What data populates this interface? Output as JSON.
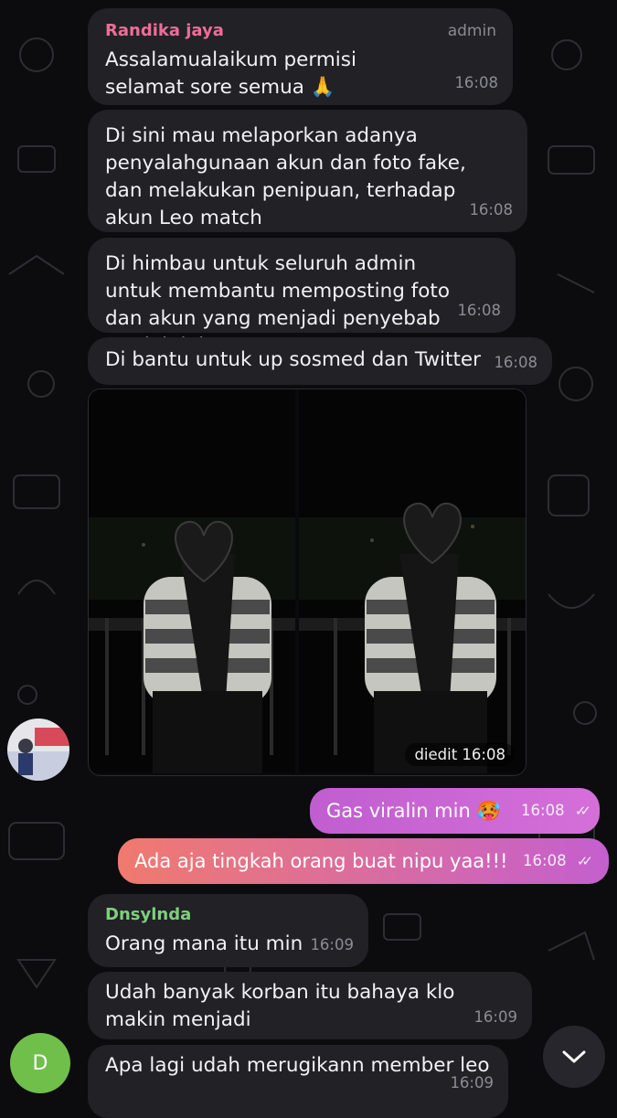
{
  "messages": [
    {
      "sender": "Randika jaya",
      "role": "admin",
      "text": "Assalamualaikum permisi selamat sore semua 🙏",
      "time": "16:08"
    },
    {
      "text": "Di sini mau melaporkan adanya penyalahgunaan akun dan foto fake, dan melakukan penipuan, terhadap akun Leo match",
      "time": "16:08"
    },
    {
      "text": "Di himbau untuk seluruh admin untuk membantu memposting foto dan akun yang menjadi penyebab Msalah ini",
      "time": "16:08"
    },
    {
      "text": "Di bantu untuk up sosmed dan Twitter",
      "time": "16:08"
    },
    {
      "caption": "diedit 16:08"
    },
    {
      "text": "Gas viralin min 🥵",
      "time": "16:08",
      "status": "read"
    },
    {
      "text": "Ada aja tingkah orang buat nipu yaa!!!",
      "time": "16:08",
      "status": "read"
    },
    {
      "sender": "Dnsylnda",
      "text": "Orang mana itu min",
      "time": "16:09"
    },
    {
      "text": "Udah banyak korban itu bahaya klo makin menjadi",
      "time": "16:09"
    },
    {
      "text": "Apa lagi udah merugikann member leo",
      "time": "16:09"
    }
  ],
  "avatars": {
    "dnsylnda_initial": "D"
  },
  "colors": {
    "background": "#0c0c0e",
    "incoming_bubble": "#212126",
    "sender_admin": "#ee6d96",
    "sender_member": "#7fcf7e",
    "outgoing_start": "#a04fd0",
    "outgoing_end": "#f0707e"
  },
  "icons": {
    "read_ticks": "double-check-icon",
    "scroll_down": "chevron-down-icon"
  }
}
